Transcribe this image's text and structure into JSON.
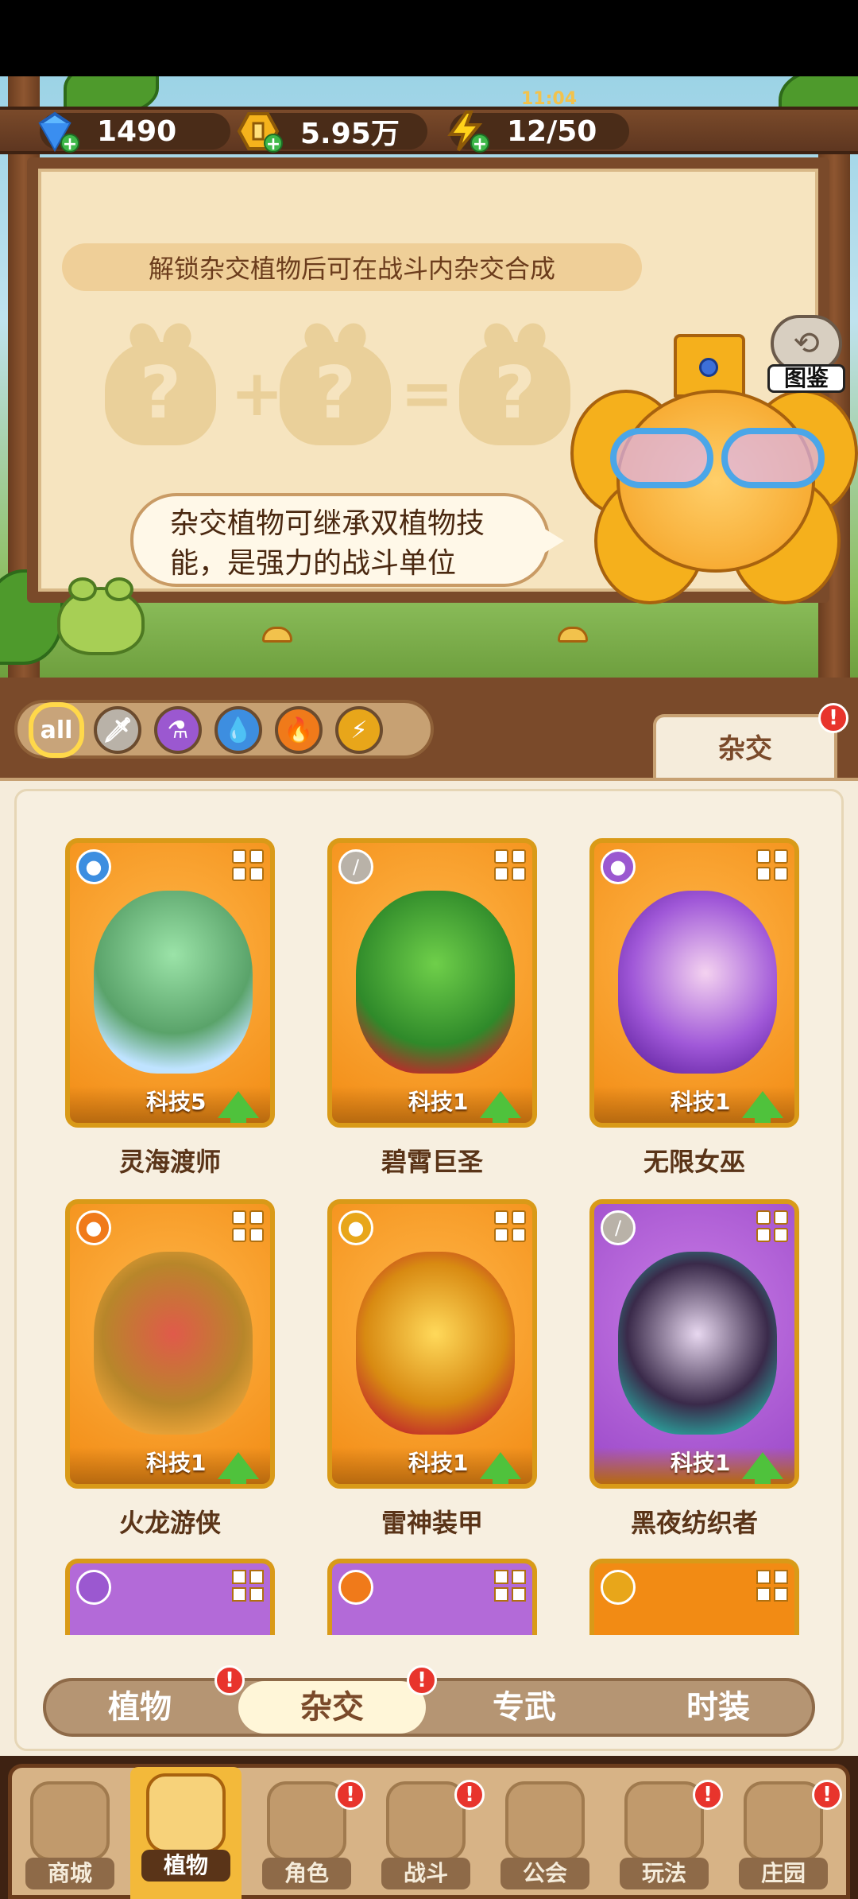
{
  "resources": {
    "gems": "1490",
    "coins": "5.95万",
    "energy": "12/50",
    "energy_timer": "11:04"
  },
  "board": {
    "hint": "解锁杂交植物后可在战斗内杂交合成",
    "speech": "杂交植物可继承双植物技能，是强力的战斗单位",
    "atlas_label": "图鉴"
  },
  "filters": {
    "all_label": "all",
    "icons": [
      "all-icon",
      "sword-icon",
      "potion-icon",
      "water-drop-icon",
      "fire-icon",
      "lightning-icon"
    ],
    "top_tab": "杂交",
    "top_tab_badge": "!"
  },
  "cards": [
    {
      "name": "灵海渡师",
      "level": "科技5",
      "element": "water-drop-icon",
      "theme": "orange"
    },
    {
      "name": "碧霄巨圣",
      "level": "科技1",
      "element": "sword-icon",
      "theme": "orange"
    },
    {
      "name": "无限女巫",
      "level": "科技1",
      "element": "potion-icon",
      "theme": "orange"
    },
    {
      "name": "火龙游侠",
      "level": "科技1",
      "element": "fire-icon",
      "theme": "orange"
    },
    {
      "name": "雷神装甲",
      "level": "科技1",
      "element": "lightning-icon",
      "theme": "orange"
    },
    {
      "name": "黑夜纺织者",
      "level": "科技1",
      "element": "sword-icon",
      "theme": "purple"
    }
  ],
  "partial_cards": [
    {
      "element": "potion-icon",
      "theme": "purple"
    },
    {
      "element": "fire-icon",
      "theme": "purple"
    },
    {
      "element": "lightning-icon",
      "theme": "orange"
    }
  ],
  "subtabs": [
    {
      "label": "植物",
      "badge": "!"
    },
    {
      "label": "杂交",
      "badge": "!",
      "selected": true
    },
    {
      "label": "专武"
    },
    {
      "label": "时装"
    }
  ],
  "nav": [
    {
      "label": "商城"
    },
    {
      "label": "植物",
      "active": true
    },
    {
      "label": "角色",
      "badge": "!"
    },
    {
      "label": "战斗",
      "badge": "!"
    },
    {
      "label": "公会"
    },
    {
      "label": "玩法",
      "badge": "!"
    },
    {
      "label": "庄园",
      "badge": "!"
    }
  ],
  "colors": {
    "accent_orange": "#f28b14",
    "purple_card": "#9a48c8",
    "badge_red": "#e8342c",
    "wood": "#7a4a2a"
  }
}
